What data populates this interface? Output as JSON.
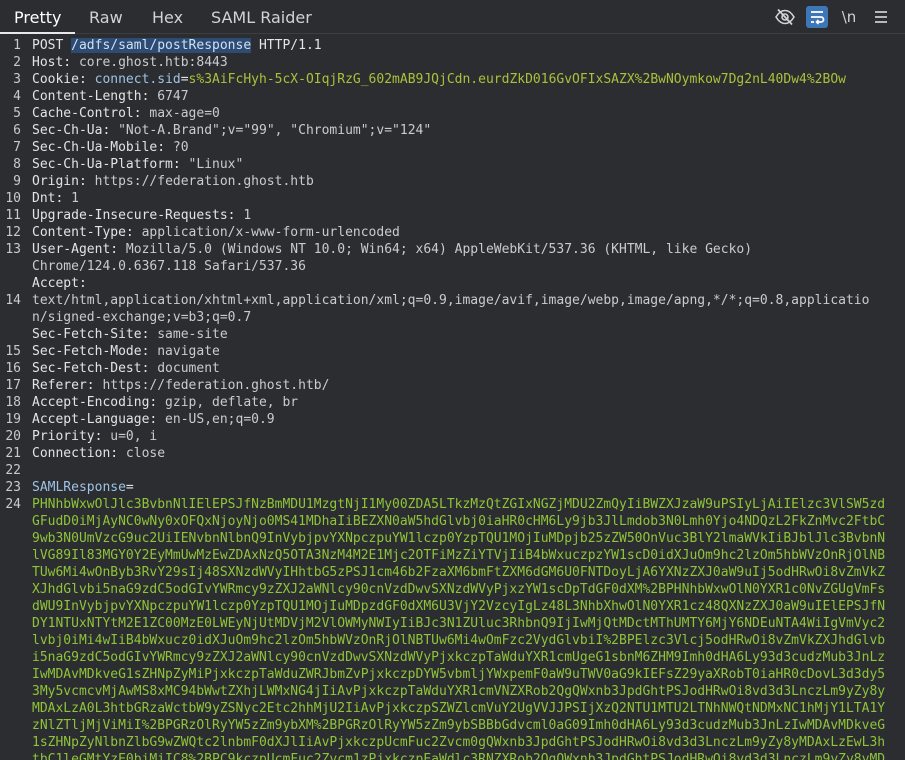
{
  "tabs": [
    "Pretty",
    "Raw",
    "Hex",
    "SAML Raider"
  ],
  "active_tab": "Pretty",
  "icons": {
    "eye_off": "eye-slash-icon",
    "wrap": "text-wrap-icon",
    "newline": "\\n",
    "menu": "hamburger-menu-icon"
  },
  "line_numbers": [
    "1",
    "2",
    "3",
    "4",
    "5",
    "6",
    "7",
    "8",
    "9",
    "10",
    "11",
    "12",
    "13",
    "14",
    "15",
    "16",
    "17",
    "18",
    "19",
    "20",
    "21",
    "22",
    "23",
    "24"
  ],
  "request": {
    "method": "POST ",
    "path": "/adfs/saml/postResponse",
    "version": " HTTP/1.1",
    "host_name": "Host:",
    "host_val": " core.ghost.htb:8443",
    "cookie_name": "Cookie:",
    "cookie_key": " connect.sid",
    "cookie_eq": "=",
    "cookie_val": "s%3AiFcHyh-5cX-OIqjRzG_602mAB9JQjCdn.eurdZkD016GvOFIxSAZX%2BwNOymkow7Dg2nL40Dw4%2BOw",
    "content_length_name": "Content-Length:",
    "content_length_val": " 6747",
    "cache_control_name": "Cache-Control:",
    "cache_control_val": " max-age=0",
    "sec_ch_ua_name": "Sec-Ch-Ua:",
    "sec_ch_ua_val": " \"Not-A.Brand\";v=\"99\", \"Chromium\";v=\"124\"",
    "sec_ch_ua_mobile_name": "Sec-Ch-Ua-Mobile:",
    "sec_ch_ua_mobile_val": " ?0",
    "sec_ch_ua_platform_name": "Sec-Ch-Ua-Platform:",
    "sec_ch_ua_platform_val": " \"Linux\"",
    "origin_name": "Origin:",
    "origin_val": " https://federation.ghost.htb",
    "dnt_name": "Dnt:",
    "dnt_val": " 1",
    "upgrade_name": "Upgrade-Insecure-Requests:",
    "upgrade_val": " 1",
    "content_type_name": "Content-Type:",
    "content_type_val": " application/x-www-form-urlencoded",
    "user_agent_name": "User-Agent:",
    "user_agent_val": " Mozilla/5.0 (Windows NT 10.0; Win64; x64) AppleWebKit/537.36 (KHTML, like Gecko)",
    "user_agent_cont": "Chrome/124.0.6367.118 Safari/537.36",
    "accept_name": "Accept:",
    "accept_val1": "text/html,application/xhtml+xml,application/xml;q=0.9,image/avif,image/webp,image/apng,*/*;q=0.8,applicatio",
    "accept_val2": "n/signed-exchange;v=b3;q=0.7",
    "sec_fetch_site_name": "Sec-Fetch-Site:",
    "sec_fetch_site_val": " same-site",
    "sec_fetch_mode_name": "Sec-Fetch-Mode:",
    "sec_fetch_mode_val": " navigate",
    "sec_fetch_dest_name": "Sec-Fetch-Dest:",
    "sec_fetch_dest_val": " document",
    "referer_name": "Referer:",
    "referer_val": " https://federation.ghost.htb/",
    "accept_encoding_name": "Accept-Encoding:",
    "accept_encoding_val": " gzip, deflate, br",
    "accept_language_name": "Accept-Language:",
    "accept_language_val": " en-US,en;q=0.9",
    "priority_name": "Priority:",
    "priority_val": " u=0, i",
    "connection_name": "Connection:",
    "connection_val": " close",
    "body_param": "SAMLResponse",
    "body_eq": "=",
    "body_value": "PHNhbWxwOlJlc3BvbnNlIElEPSJfNzBmMDU1MzgtNjI1My00ZDA5LTkzMzQtZGIxNGZjMDU2ZmQyIiBWZXJzaW9uPSIyLjAiIElzc3VlSW5zdGFudD0iMjAyNC0wNy0xOFQxNjoyNjo0MS41MDhaIiBEZXN0aW5hdGlvbj0iaHR0cHM6Ly9jb3JlLmdob3N0Lmh0Yjo4NDQzL2FkZnMvc2FtbC9wb3N0UmVzcG9uc2UiIENvbnNlbnQ9InVybjpvYXNpczpuYW1lczp0YzpTQU1MOjIuMDpjb25zZW50OnVuc3BlY2lmaWVkIiBJblJlc3BvbnNlVG89Il83MGY0Y2EyMmUwMzEwZDAxNzQ5OTA3NzM4M2E1Mjc2OTFiMzZiYTVjIiB4bWxuczpzYW1scD0idXJuOm9hc2lzOm5hbWVzOnRjOlNBTUw6Mi4wOnByb3RvY29sIj48SXNzdWVyIHhtbG5zPSJ1cm46b2FzaXM6bmFtZXM6dGM6U0FNTDoyLjA6YXNzZXJ0aW9uIj5odHRwOi8vZmVkZXJhdGlvbi5naG9zdC5odGIvYWRmcy9zZXJ2aWNlcy90cnVzdDwvSXNzdWVyPjxzYW1scDpTdGF0dXM%2BPHNhbWxwOlN0YXR1c0NvZGUgVmFsdWU9InVybjpvYXNpczpuYW1lczp0YzpTQU1MOjIuMDpzdGF0dXM6U3VjY2VzcyIgLz48L3NhbXhwOlN0YXR1cz48QXNzZXJ0aW9uIElEPSJfNDY1NTUxNTYtM2E1ZC00MzE0LWEyNjUtMDVjM2VlOWMyNWIyIiBJc3N1ZUluc3RhbnQ9IjIwMjQtMDctMThUMTY6MjY6NDEuNTA4WiIgVmVyc2lvbj0iMi4wIiB4bWxucz0idXJuOm9hc2lzOm5hbWVzOnRjOlNBTUw6Mi4wOmFzc2VydGlvbiI%2BPElzc3Vlcj5odHRwOi8vZmVkZXJhdGlvbi5naG9zdC5odGIvYWRmcy9zZXJ2aWNlcy90cnVzdDwvSXNzdWVyPjxkczpTaWduYXR1cmUgeG1sbnM6ZHM9Imh0dHA6Ly93d3cudzMub3JnLzIwMDAvMDkveG1sZHNpZyMiPjxkczpTaWduZWRJbmZvPjxkczpDYW5vbmljYWxpemF0aW9uTWV0aG9kIEFsZ29yaXRobT0iaHR0cDovL3d3dy53My5vcmcvMjAwMS8xMC94bWwtZXhjLWMxNG4jIiAvPjxkczpTaWduYXR1cmVNZXRob2QgQWxnb3JpdGhtPSJodHRwOi8vd3d3LnczLm9yZy8yMDAxLzA0L3htbGRzaWctbW9yZSNyc2Etc2hhMjU2IiAvPjxkczpSZWZlcmVuY2UgVVJJPSIjXzQ2NTU1MTU2LTNhNWQtNDMxNC1hMjY1LTA1YzNlZTljMjViMiI%2BPGRzOlRyYW5zZm9ybXM%2BPGRzOlRyYW5zZm9ybSBBbGdvcml0aG09Imh0dHA6Ly93d3cudzMub3JnLzIwMDAvMDkveG1sZHNpZyNlbnZlbG9wZWQtc2lnbmF0dXJlIiAvPjxkczpUcmFuc2Zvcm0gQWxnb3JpdGhtPSJodHRwOi8vd3d3LnczLm9yZy8yMDAxLzEwL3htbC1leGMtYzE0biMiIC8%2BPC9kczpUcmFuc2Zvcm1zPjxkczpEaWdlc3RNZXRob2QgQWxnb3JpdGhtPSJodHRwOi8vd3d3LnczLm9yZy8yMDAxLzA0L3htbGVuYyNzaGEyNTYiIC8%2BPGRzOkRpZ2VzdFZhbHVlPg"
  }
}
